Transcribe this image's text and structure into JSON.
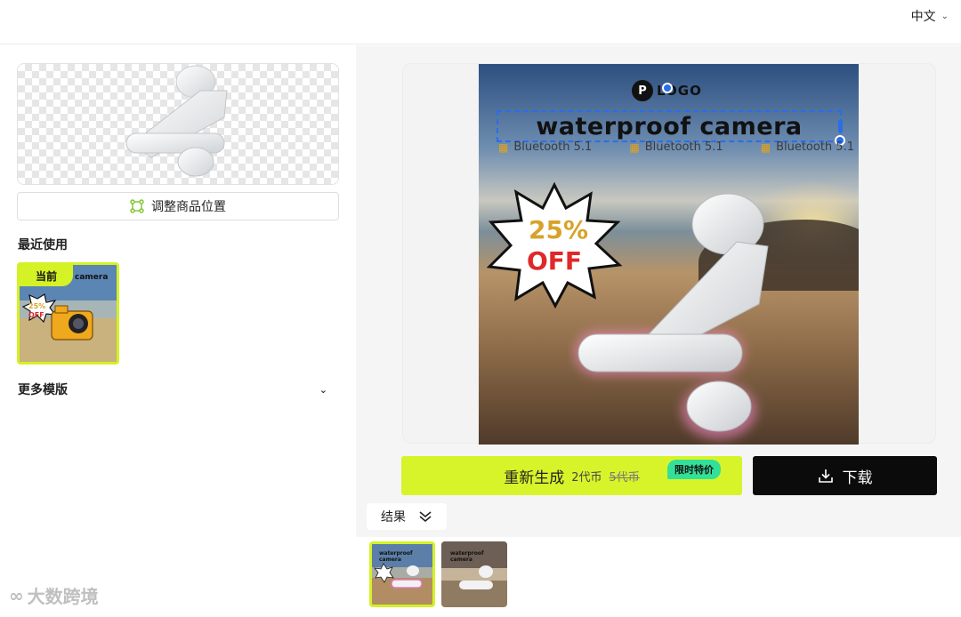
{
  "header": {
    "language_label": "中文"
  },
  "left_panel": {
    "adjust_position_label": "调整商品位置",
    "recent_title": "最近使用",
    "recent_items": [
      {
        "tag": "当前",
        "title_text": "camera",
        "badge_top": "25%",
        "badge_bottom": "OFF"
      }
    ],
    "more_templates_label": "更多模版"
  },
  "poster": {
    "logo_letter": "P",
    "logo_text": "LOGO",
    "headline": "waterproof camera",
    "features": [
      "Bluetooth 5.1",
      "Bluetooth 5.1",
      "Bluetooth 5.1"
    ],
    "badge_top": "25%",
    "badge_bottom": "OFF"
  },
  "actions": {
    "regenerate_label": "重新生成",
    "price_current": "2代币",
    "price_original": "5代币",
    "promo_tag": "限时特价",
    "download_label": "下载"
  },
  "results": {
    "toggle_label": "结果",
    "thumbnails": [
      {
        "selected": true,
        "caption": "waterproof camera"
      },
      {
        "selected": false,
        "caption": "waterproof camera"
      }
    ]
  },
  "watermark": {
    "text": "大数跨境"
  },
  "colors": {
    "accent_lime": "#d7f42a",
    "promo_green": "#33e09a",
    "selection_blue": "#2a6ee8",
    "download_black": "#0b0b0b"
  }
}
